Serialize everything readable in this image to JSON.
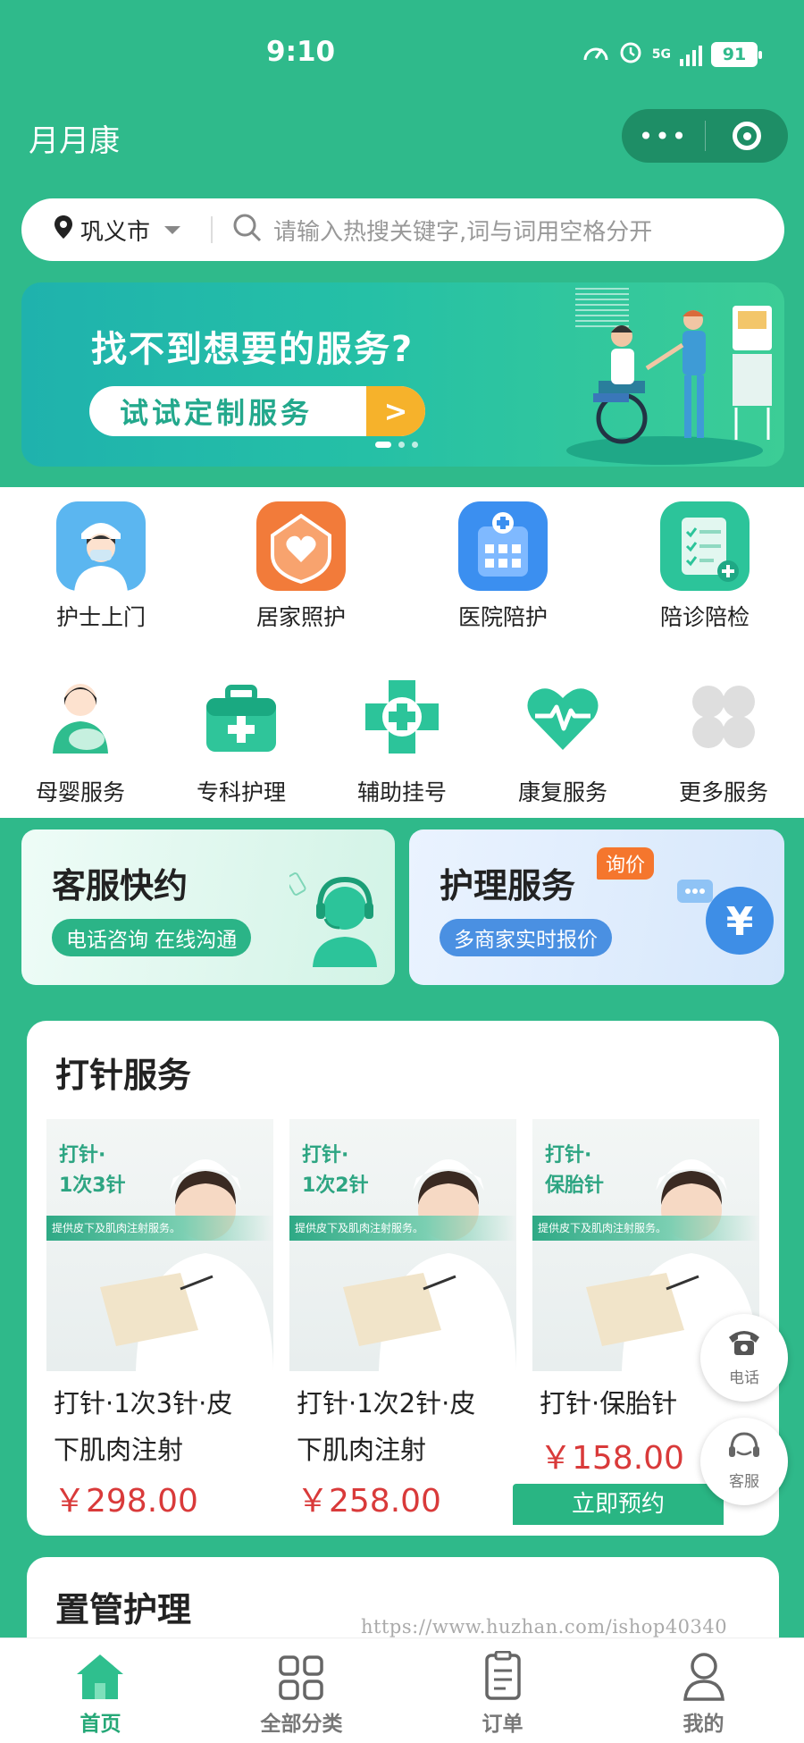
{
  "status": {
    "time": "9:10",
    "network": "5G",
    "battery": "91"
  },
  "header": {
    "title": "月月康",
    "more_icon": "more-dots-icon",
    "close_icon": "target-icon"
  },
  "search": {
    "city": "巩义市",
    "placeholder": "请输入热搜关键字,词与词用空格分开"
  },
  "banner": {
    "title": "找不到想要的服务?",
    "button_label": "试试定制服务",
    "arrow": ">"
  },
  "services_row1": [
    {
      "label": "护士上门",
      "icon": "nurse-icon"
    },
    {
      "label": "居家照护",
      "icon": "home-care-icon"
    },
    {
      "label": "医院陪护",
      "icon": "hospital-icon"
    },
    {
      "label": "陪诊陪检",
      "icon": "checklist-icon"
    }
  ],
  "services_row2": [
    {
      "label": "母婴服务",
      "icon": "mother-baby-icon"
    },
    {
      "label": "专科护理",
      "icon": "medical-kit-icon"
    },
    {
      "label": "辅助挂号",
      "icon": "medical-cross-icon"
    },
    {
      "label": "康复服务",
      "icon": "heart-pulse-icon"
    },
    {
      "label": "更多服务",
      "icon": "more-grid-icon"
    }
  ],
  "quick_cards": {
    "service": {
      "title": "客服快约",
      "tag": "电话咨询 在线沟通",
      "icon": "customer-service-icon"
    },
    "nursing": {
      "title": "护理服务",
      "badge": "询价",
      "tag": "多商家实时报价",
      "icon": "yuan-icon"
    }
  },
  "injection": {
    "title": "打针服务",
    "products": [
      {
        "img_title": "打针·\n1次3针",
        "img_desc": "提供皮下及肌肉注射服务。",
        "name_line1": "打针·1次3针·皮",
        "name_line2": "下肌肉注射",
        "price": "￥298.00"
      },
      {
        "img_title": "打针·\n1次2针",
        "img_desc": "提供皮下及肌肉注射服务。",
        "name_line1": "打针·1次2针·皮",
        "name_line2": "下肌肉注射",
        "price": "￥258.00"
      },
      {
        "img_title": "打针·\n保胎针",
        "img_desc": "提供皮下及肌肉注射服务。",
        "name_line1": "打针·保胎针",
        "name_line2": "",
        "price": "￥158.00"
      }
    ],
    "book_label": "立即预约"
  },
  "float": {
    "phone_label": "电话",
    "service_label": "客服"
  },
  "tube": {
    "title": "置管护理"
  },
  "watermark": "https://www.huzhan.com/ishop40340",
  "tabbar": [
    {
      "label": "首页",
      "icon": "home-icon",
      "active": true
    },
    {
      "label": "全部分类",
      "icon": "category-grid-icon",
      "active": false
    },
    {
      "label": "订单",
      "icon": "order-list-icon",
      "active": false
    },
    {
      "label": "我的",
      "icon": "user-icon",
      "active": false
    }
  ],
  "colors": {
    "brand": "#2fba8b",
    "price": "#d93a3a",
    "accent": "#f6b22b",
    "active_tab": "#25a877"
  }
}
